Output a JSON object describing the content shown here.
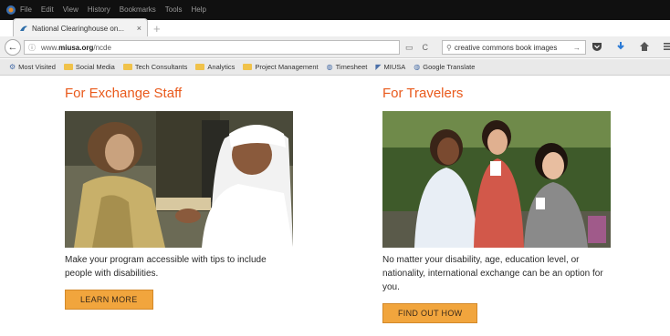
{
  "browser": {
    "menu": [
      "File",
      "Edit",
      "View",
      "History",
      "Bookmarks",
      "Tools",
      "Help"
    ],
    "tab": {
      "title": "National Clearinghouse on...",
      "close": "×",
      "favicon": "miusa-logo-icon"
    },
    "new_tab": "+",
    "back": "←",
    "url": {
      "prefix": "www.",
      "domain": "miusa.org",
      "path": "/ncde"
    },
    "url_tools": {
      "reader": "▭",
      "reload": "C"
    },
    "search": {
      "value": "creative commons book images",
      "go": "→"
    },
    "toolbar_icons": [
      "pocket-icon",
      "download-icon",
      "home-icon",
      "menu-icon"
    ],
    "bookmarks": [
      {
        "label": "Most Visited",
        "icon": "gear-icon"
      },
      {
        "label": "Social Media",
        "icon": "folder-icon"
      },
      {
        "label": "Tech Consultants",
        "icon": "folder-icon"
      },
      {
        "label": "Analytics",
        "icon": "folder-icon"
      },
      {
        "label": "Project Management",
        "icon": "folder-icon"
      },
      {
        "label": "Timesheet",
        "icon": "globe-icon"
      },
      {
        "label": "MIUSA",
        "icon": "miusa-logo-icon"
      },
      {
        "label": "Google Translate",
        "icon": "globe-icon"
      }
    ]
  },
  "page": {
    "accent_color": "#e95a1c",
    "button_color": "#f1a53d",
    "left": {
      "title": "For Exchange Staff",
      "description": "Make your program accessible with tips to include people with disabilities.",
      "button": "LEARN MORE"
    },
    "right": {
      "title": "For Travelers",
      "description": "No matter your disability, age, education level, or nationality, international exchange can be an option for you.",
      "button": "FIND OUT HOW"
    }
  }
}
